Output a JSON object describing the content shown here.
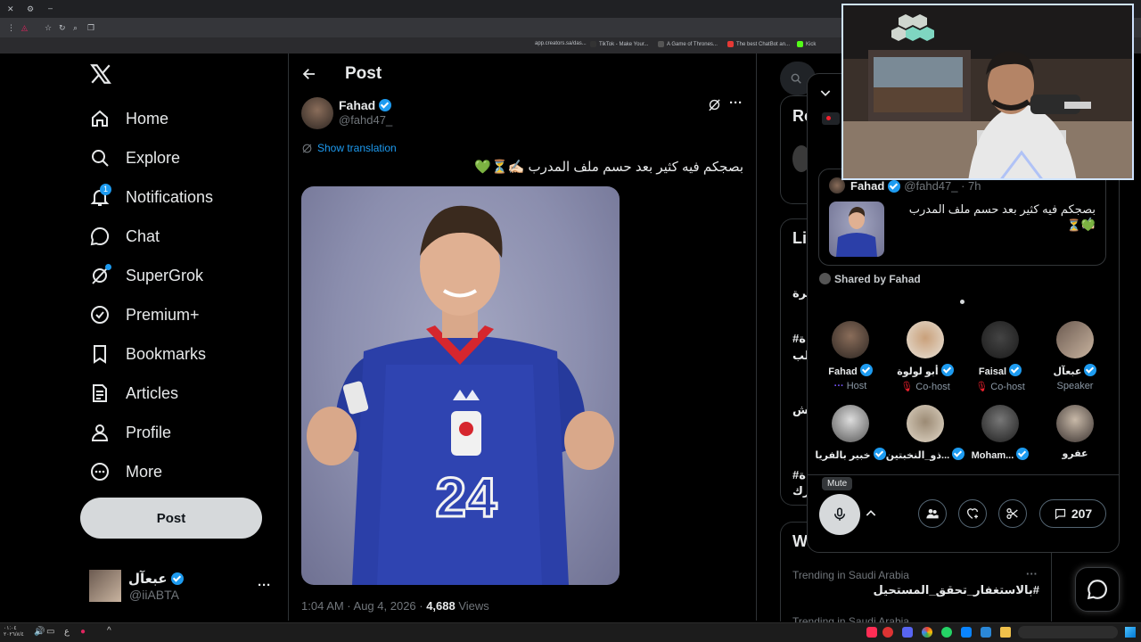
{
  "browser": {
    "bookmarks": [
      "app.creators.sa/das...",
      "TikTok - Make Your...",
      "A Game of Thrones...",
      "The best ChatBot an...",
      "Kick"
    ]
  },
  "nav": {
    "items": [
      {
        "label": "Home",
        "icon": "home-icon"
      },
      {
        "label": "Explore",
        "icon": "search-icon"
      },
      {
        "label": "Notifications",
        "icon": "bell-icon",
        "badge": "1"
      },
      {
        "label": "Chat",
        "icon": "chat-icon"
      },
      {
        "label": "SuperGrok",
        "icon": "grok-icon"
      },
      {
        "label": "Premium+",
        "icon": "verified-outline-icon"
      },
      {
        "label": "Bookmarks",
        "icon": "bookmark-icon"
      },
      {
        "label": "Articles",
        "icon": "article-icon"
      },
      {
        "label": "Profile",
        "icon": "person-icon"
      },
      {
        "label": "More",
        "icon": "more-circle-icon"
      }
    ],
    "post_button": "Post",
    "account": {
      "name": "عبعآل",
      "handle": "@iiABTA",
      "more": "···"
    }
  },
  "post": {
    "header_title": "Post",
    "author_name": "Fahad",
    "author_handle": "@fahd47_",
    "show_translation": "Show translation",
    "text": "بصجكم فيه كثير بعد حسم ملف المدرب ✍🏻⏳💚",
    "jersey_number": "24",
    "jersey_label": "JAPAN",
    "time": "1:04 AM · Aug 4, 2026 · ",
    "views_count": "4,688",
    "views_label": " Views"
  },
  "right": {
    "partial_labels": [
      "Ro",
      "Li",
      "W"
    ],
    "partial_rows": [
      "يرة",
      "#ة",
      "لب",
      "ش",
      "#ة",
      "رك"
    ],
    "trending_context": "Trending in Saudi Arabia",
    "trending_tag": "#بالاستغفار_تحقق_المستحيل",
    "trending_more": "···",
    "next_context": "Trending in Saudi Arabia"
  },
  "space": {
    "shared_tweet_author": "Fahad",
    "shared_tweet_handle": "@fahd47_ · 7h",
    "shared_tweet_text": "بصجكم فيه كثير بعد حسم ملف المدرب ✍🏻",
    "shared_tweet_text2": "💚⏳",
    "shared_by": "Shared by Fahad",
    "members": [
      {
        "name": "Fahad",
        "role": "Host",
        "role_icon": "dots"
      },
      {
        "name": "أبو لولوة",
        "role": "Co-host",
        "role_icon": "mic-off"
      },
      {
        "name": "Faisal",
        "role": "Co-host",
        "role_icon": "mic-off"
      },
      {
        "name": "عبعآل",
        "role": "Speaker",
        "role_icon": ""
      },
      {
        "name": "خبير بالفريا",
        "role": "",
        "role_icon": ""
      },
      {
        "name": "ذو_النخبتين...",
        "role": "",
        "role_icon": ""
      },
      {
        "name": "Moham...",
        "role": "",
        "role_icon": ""
      },
      {
        "name": "عفرو",
        "role": "",
        "role_icon": ""
      }
    ],
    "mute_tooltip": "Mute",
    "comment_count": "207"
  },
  "colors": {
    "accent": "#1d9bf0",
    "background": "#000000",
    "border": "#2f3336",
    "muted": "#71767b"
  }
}
